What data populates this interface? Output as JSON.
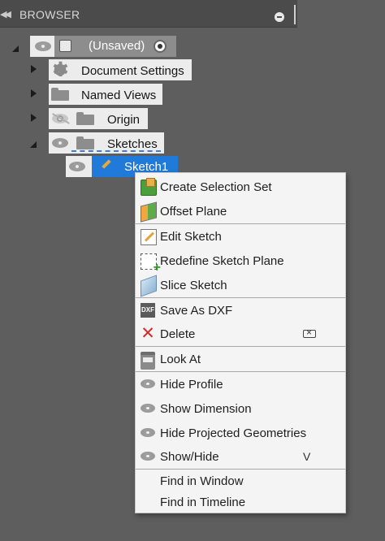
{
  "header": {
    "title": "BROWSER",
    "collapse_icon": "double-left-arrow-icon",
    "minus_icon": "minus-circle-icon"
  },
  "tree": {
    "root": {
      "label": "(Unsaved)",
      "icons": [
        "eye-icon",
        "component-icon",
        "radio-active-icon"
      ]
    },
    "items": [
      {
        "label": "Document Settings",
        "icon": "gear-icon"
      },
      {
        "label": "Named Views",
        "icon": "folder-icon"
      },
      {
        "label": "Origin",
        "icons": [
          "eye-hidden-icon",
          "folder-icon"
        ]
      },
      {
        "label": "Sketches",
        "icons": [
          "eye-icon",
          "folder-icon"
        ]
      }
    ],
    "selected": {
      "label": "Sketch1",
      "icons": [
        "eye-icon",
        "sketch-pencil-icon"
      ],
      "highlight_color": "#1f7ad9"
    }
  },
  "menu": {
    "items": [
      {
        "label": "Create Selection Set",
        "icon": "selection-set-icon"
      },
      {
        "label": "Offset Plane",
        "icon": "offset-plane-icon"
      },
      {
        "label": "Edit Sketch",
        "icon": "edit-sketch-icon"
      },
      {
        "label": "Redefine Sketch Plane",
        "icon": "redefine-plane-icon"
      },
      {
        "label": "Slice Sketch",
        "icon": "slice-icon"
      },
      {
        "label": "Save As DXF",
        "icon": "dxf-icon",
        "icon_text": "DXF"
      },
      {
        "label": "Delete",
        "icon": "delete-x-icon",
        "shortcut_icon": "erase-key-icon"
      },
      {
        "label": "Look At",
        "icon": "look-at-icon"
      },
      {
        "label": "Hide Profile",
        "icon": "eye-icon"
      },
      {
        "label": "Show Dimension",
        "icon": "eye-icon"
      },
      {
        "label": "Hide Projected Geometries",
        "icon": "eye-icon"
      },
      {
        "label": "Show/Hide",
        "icon": "eye-icon",
        "shortcut": "V"
      },
      {
        "label": "Find in Window"
      },
      {
        "label": "Find in Timeline"
      }
    ]
  }
}
